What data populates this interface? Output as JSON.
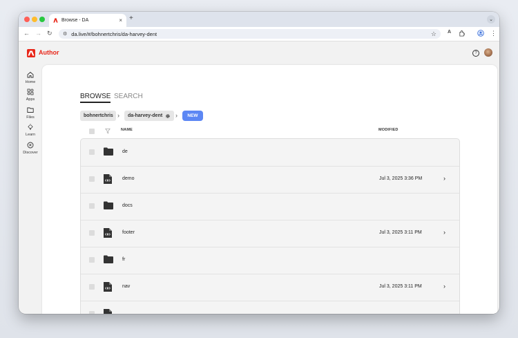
{
  "browser": {
    "tab_title": "Browse - DA",
    "tab_close": "×",
    "new_tab": "+",
    "tab_menu": "⌄",
    "url": "da.live/#/bohnertchris/da-harvey-dent",
    "traffic_colors": [
      "#ff5f57",
      "#febc2e",
      "#28c840"
    ]
  },
  "app": {
    "name": "Author",
    "brand_color": "#e8271a",
    "help_glyph": "?"
  },
  "sidebar": {
    "items": [
      {
        "label": "Home",
        "icon": "home-icon"
      },
      {
        "label": "Apps",
        "icon": "apps-icon"
      },
      {
        "label": "Files",
        "icon": "folder-icon"
      },
      {
        "label": "Learn",
        "icon": "lightbulb-icon"
      },
      {
        "label": "Discover",
        "icon": "compass-icon"
      }
    ]
  },
  "main": {
    "tabs": [
      {
        "label": "BROWSE",
        "active": true
      },
      {
        "label": "SEARCH",
        "active": false
      }
    ],
    "breadcrumb": [
      "bohnertchris",
      "da-harvey-dent"
    ],
    "breadcrumb_sep": "›",
    "new_button": "NEW",
    "new_button_color": "#5c87f4",
    "columns": {
      "name": "NAME",
      "modified": "MODIFIED"
    },
    "rows": [
      {
        "name": "de",
        "type": "folder",
        "modified": "",
        "chevron": ""
      },
      {
        "name": "demo",
        "type": "document",
        "modified": "Jul 3, 2025 3:36 PM",
        "chevron": "›"
      },
      {
        "name": "docs",
        "type": "folder",
        "modified": "",
        "chevron": ""
      },
      {
        "name": "footer",
        "type": "document",
        "modified": "Jul 3, 2025 3:11 PM",
        "chevron": "›"
      },
      {
        "name": "fr",
        "type": "folder",
        "modified": "",
        "chevron": ""
      },
      {
        "name": "nav",
        "type": "document",
        "modified": "Jul 3, 2025 3:11 PM",
        "chevron": "›"
      }
    ]
  }
}
